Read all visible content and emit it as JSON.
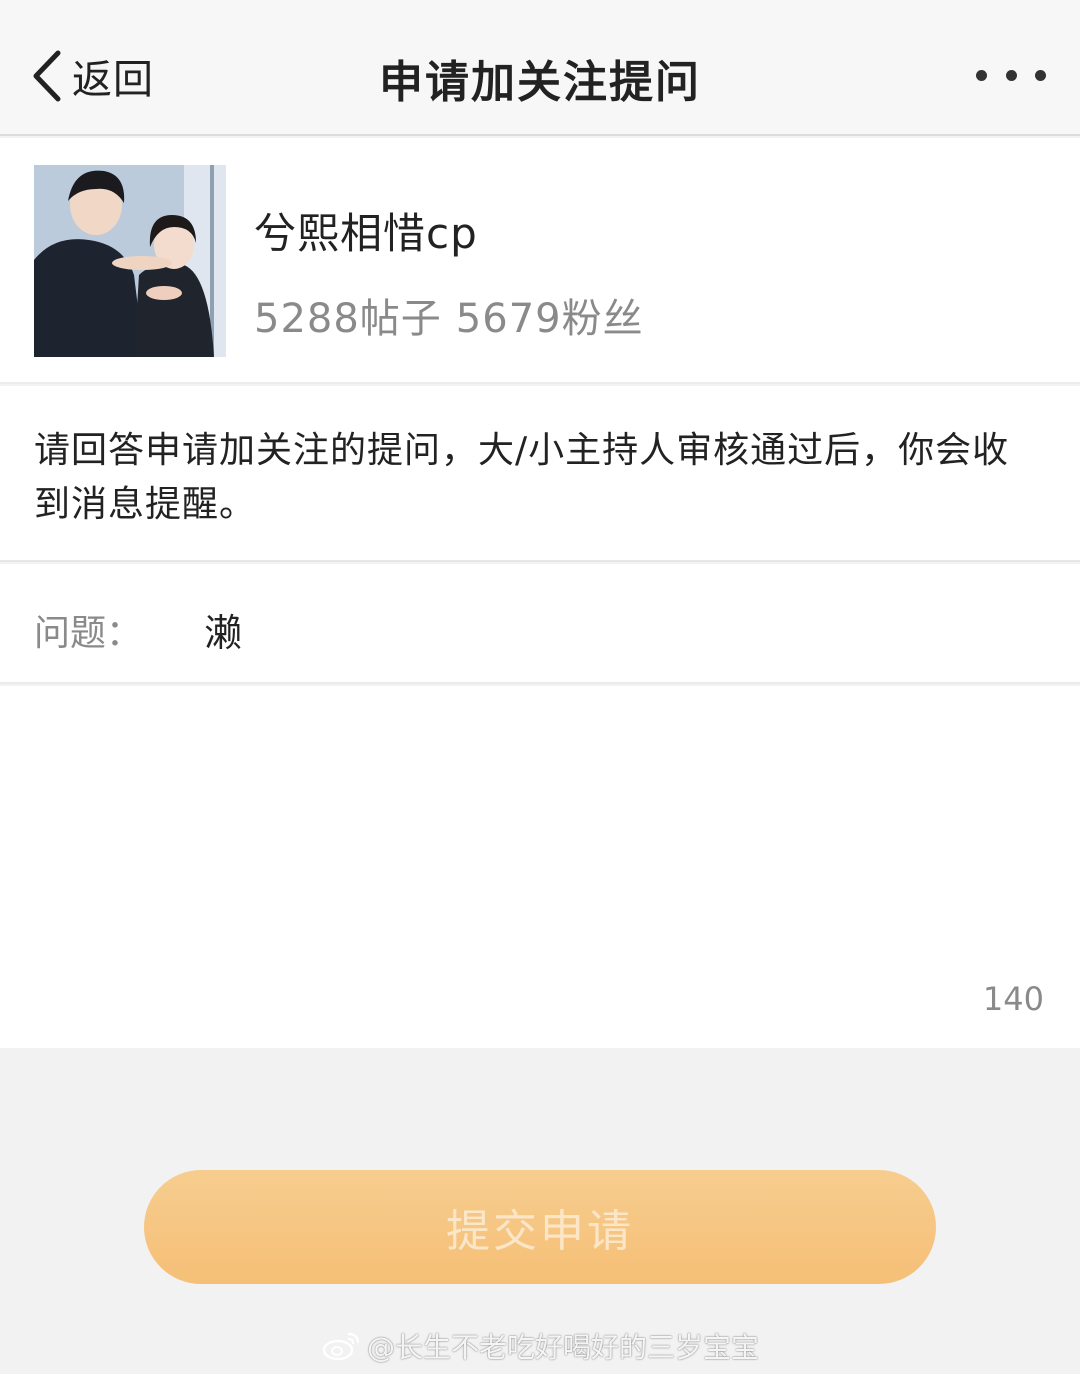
{
  "navbar": {
    "back_label": "返回",
    "title": "申请加关注提问",
    "back_icon": "chevron-left-icon",
    "more_icon": "more-dots-icon"
  },
  "forum": {
    "name": "兮熙相惜cp",
    "posts": "5288帖子",
    "fans": "5679粉丝"
  },
  "notice": {
    "text": "请回答申请加关注的提问，大/小主持人审核通过后，你会收到消息提醒。"
  },
  "question": {
    "label": "问题：",
    "value": "濑"
  },
  "answer": {
    "value": "",
    "remaining": "140"
  },
  "submit": {
    "label": "提交申请"
  },
  "watermark": {
    "text": "@长生不老吃好喝好的三岁宝宝",
    "icon": "weibo-logo-icon"
  },
  "colors": {
    "submit_gradient_top": "#f7cd8f",
    "submit_gradient_bottom": "#f5bf76",
    "submit_text": "#fbe6c8",
    "background": "#f2f2f2",
    "muted_text": "#8a8a8a"
  }
}
